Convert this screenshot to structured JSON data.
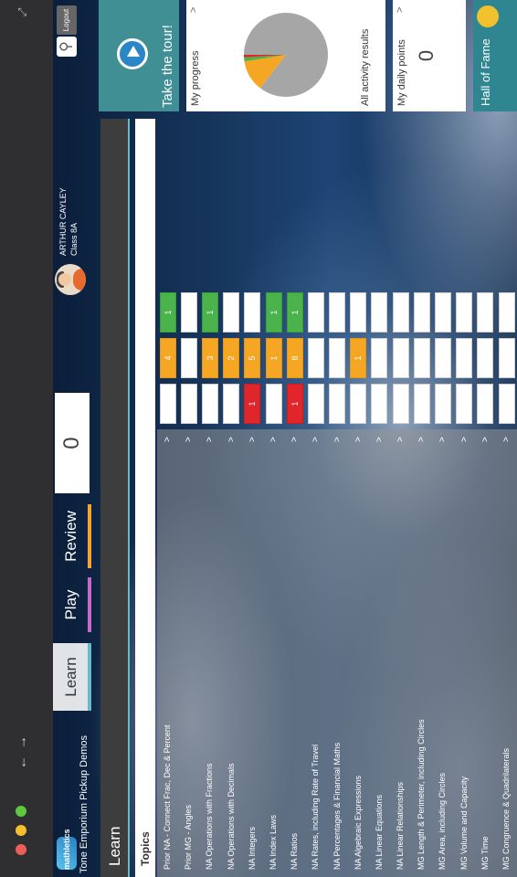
{
  "window": {
    "site_title": "Tone Emporium Pickup Demos"
  },
  "header": {
    "logo_text": "mathletics",
    "tabs": [
      {
        "label": "Learn",
        "color": "#6ab9c7"
      },
      {
        "label": "Play",
        "color": "#c36bc5"
      },
      {
        "label": "Review",
        "color": "#f4a431"
      }
    ],
    "points": "0",
    "user": {
      "name": "ARTHUR CAYLEY",
      "class": "Class 8A"
    },
    "logout_label": "Logout"
  },
  "learn": {
    "title": "Learn",
    "topics_header": "Topics",
    "rows": [
      {
        "label": "Prior NA - Connect Frac, Dec & Percent",
        "cells": [
          {
            "v": "",
            "c": "white"
          },
          {
            "v": "4",
            "c": "orange"
          },
          {
            "v": "1",
            "c": "green"
          }
        ]
      },
      {
        "label": "Prior MG - Angles",
        "cells": [
          {
            "v": "",
            "c": "white"
          },
          {
            "v": "",
            "c": "white"
          },
          {
            "v": "",
            "c": "white"
          }
        ]
      },
      {
        "label": "NA Operations with Fractions",
        "cells": [
          {
            "v": "",
            "c": "white"
          },
          {
            "v": "3",
            "c": "orange"
          },
          {
            "v": "1",
            "c": "green"
          }
        ]
      },
      {
        "label": "NA Operations with Decimals",
        "cells": [
          {
            "v": "",
            "c": "white"
          },
          {
            "v": "2",
            "c": "orange"
          },
          {
            "v": "",
            "c": "white"
          }
        ]
      },
      {
        "label": "NA Integers",
        "cells": [
          {
            "v": "1",
            "c": "red"
          },
          {
            "v": "5",
            "c": "orange"
          },
          {
            "v": "",
            "c": "white"
          }
        ]
      },
      {
        "label": "NA Index Laws",
        "cells": [
          {
            "v": "",
            "c": "white"
          },
          {
            "v": "1",
            "c": "orange"
          },
          {
            "v": "1",
            "c": "green"
          }
        ]
      },
      {
        "label": "NA Ratios",
        "cells": [
          {
            "v": "1",
            "c": "red"
          },
          {
            "v": "8",
            "c": "orange"
          },
          {
            "v": "1",
            "c": "green"
          }
        ]
      },
      {
        "label": "NA Rates, including Rate of Travel",
        "cells": [
          {
            "v": "",
            "c": "white"
          },
          {
            "v": "",
            "c": "white"
          },
          {
            "v": "",
            "c": "white"
          }
        ]
      },
      {
        "label": "NA Percentages & Financial Maths",
        "cells": [
          {
            "v": "",
            "c": "white"
          },
          {
            "v": "",
            "c": "white"
          },
          {
            "v": "",
            "c": "white"
          }
        ]
      },
      {
        "label": "NA Algebraic Expressions",
        "cells": [
          {
            "v": "",
            "c": "white"
          },
          {
            "v": "1",
            "c": "orange"
          },
          {
            "v": "",
            "c": "white"
          }
        ]
      },
      {
        "label": "NA Linear Equations",
        "cells": [
          {
            "v": "",
            "c": "white"
          },
          {
            "v": "",
            "c": "white"
          },
          {
            "v": "",
            "c": "white"
          }
        ]
      },
      {
        "label": "NA Linear Relationships",
        "cells": [
          {
            "v": "",
            "c": "white"
          },
          {
            "v": "",
            "c": "white"
          },
          {
            "v": "",
            "c": "white"
          }
        ]
      },
      {
        "label": "MG Length & Perimeter, including Circles",
        "cells": [
          {
            "v": "",
            "c": "white"
          },
          {
            "v": "",
            "c": "white"
          },
          {
            "v": "",
            "c": "white"
          }
        ]
      },
      {
        "label": "MG Area, including Circles",
        "cells": [
          {
            "v": "",
            "c": "white"
          },
          {
            "v": "",
            "c": "white"
          },
          {
            "v": "",
            "c": "white"
          }
        ]
      },
      {
        "label": "MG Volume and Capacity",
        "cells": [
          {
            "v": "",
            "c": "white"
          },
          {
            "v": "",
            "c": "white"
          },
          {
            "v": "",
            "c": "white"
          }
        ]
      },
      {
        "label": "MG Time",
        "cells": [
          {
            "v": "",
            "c": "white"
          },
          {
            "v": "",
            "c": "white"
          },
          {
            "v": "",
            "c": "white"
          }
        ]
      },
      {
        "label": "MG Congruence & Quadrilaterals",
        "cells": [
          {
            "v": "",
            "c": "white"
          },
          {
            "v": "",
            "c": "white"
          },
          {
            "v": "",
            "c": "white"
          }
        ]
      }
    ]
  },
  "sidebar": {
    "tour_label": "Take the tour!",
    "progress": {
      "title": "My progress",
      "label": "All activity results",
      "slices": [
        {
          "value": 85.5,
          "color": "#a6a6a6"
        },
        {
          "value": 12,
          "color": "#f5a623"
        },
        {
          "value": 1.5,
          "color": "#4bb34b"
        },
        {
          "value": 1,
          "color": "#e0262a"
        }
      ]
    },
    "daily_points": {
      "title": "My daily points",
      "value": "0"
    },
    "hall_of_fame": "Hall of Fame"
  }
}
